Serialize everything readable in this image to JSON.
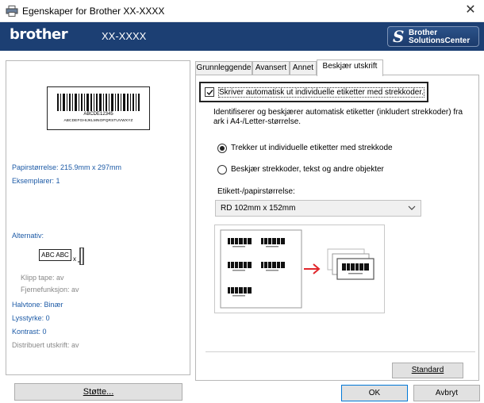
{
  "window": {
    "title": "Egenskaper for Brother  XX-XXXX",
    "close_glyph": "✕"
  },
  "banner": {
    "logo": "brother",
    "model": "XX-XXXX",
    "solutions_center": {
      "line1": "Brother",
      "line2": "SolutionsCenter"
    }
  },
  "preview": {
    "barcode_text": "ABCDE12345",
    "alphabet_text": "ABCDEFGHIJKLMNOPQRSTUVWXYZ"
  },
  "info": {
    "paper_size": "Papirstørrelse: 215.9mm x 297mm",
    "copies": "Eksemplarer: 1",
    "options_heading": "Alternativ:",
    "option_icon_text": "ABC ABC",
    "option_icon_x": "x",
    "cut_tape": "Klipp tape: av",
    "margin_removal": "Fjernefunksjon: av",
    "halftone": "Halvtone: Binær",
    "brightness": "Lysstyrke:  0",
    "contrast": "Kontrast:  0",
    "distributed_print": "Distribuert utskrift: av"
  },
  "buttons": {
    "support": "Støtte...",
    "standard": "Standard",
    "ok": "OK",
    "cancel": "Avbryt"
  },
  "tabs": [
    {
      "label": "Grunnleggende",
      "active": false
    },
    {
      "label": "Avansert",
      "active": false
    },
    {
      "label": "Annet",
      "active": false
    },
    {
      "label": "Beskjær utskrift",
      "active": true
    }
  ],
  "crop_tab": {
    "auto_print_checkbox": {
      "label": "Skriver automatisk ut individuelle etiketter med strekkoder.",
      "checked": true
    },
    "description": "Identifiserer og beskjærer automatisk etiketter (inkludert strekkoder) fra ark i A4-/Letter-størrelse.",
    "radio_options": [
      {
        "label": "Trekker ut individuelle etiketter med strekkode",
        "selected": true
      },
      {
        "label": "Beskjær strekkoder, tekst og andre objekter",
        "selected": false
      }
    ],
    "size_label": "Etikett-/papirstørrelse:",
    "size_value": "RD 102mm x 152mm"
  },
  "colors": {
    "banner": "#1c3f73",
    "info_text": "#1c5aa6",
    "arrow": "#e0262b"
  }
}
